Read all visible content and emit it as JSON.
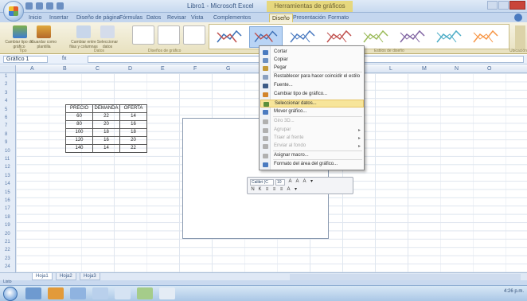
{
  "window": {
    "title": "Libro1 - Microsoft Excel",
    "context_title": "Herramientas de gráficos"
  },
  "tabs": [
    "Inicio",
    "Insertar",
    "Diseño de página",
    "Fórmulas",
    "Datos",
    "Revisar",
    "Vista",
    "Complementos",
    "Diseño",
    "Presentación",
    "Formato"
  ],
  "active_tab": "Diseño",
  "ribbon": {
    "buttons": [
      "Cambiar tipo de gráfico",
      "Guardar como plantilla",
      "Cambiar entre filas y columnas",
      "Seleccionar datos"
    ],
    "groups": [
      "Tipo",
      "Datos",
      "Diseños de gráfico",
      "Estilos de diseño",
      "Ubicación"
    ],
    "move_chart": "Mover gráfico"
  },
  "formula_bar": {
    "name_box": "Gráfico 1",
    "fx": "fx",
    "content": ""
  },
  "columns": [
    "A",
    "B",
    "C",
    "D",
    "E",
    "F",
    "G",
    "H",
    "I",
    "J",
    "K",
    "L",
    "M",
    "N",
    "O"
  ],
  "rows": [
    "1",
    "2",
    "3",
    "4",
    "5",
    "6",
    "7",
    "8",
    "9",
    "10",
    "11",
    "12",
    "13",
    "14",
    "15",
    "16",
    "17",
    "18",
    "19",
    "20",
    "21",
    "22",
    "23",
    "24"
  ],
  "table": {
    "headers": [
      "PRECIO",
      "DEMANDA",
      "OFERTA"
    ],
    "rows": [
      [
        "60",
        "22",
        "14"
      ],
      [
        "80",
        "20",
        "16"
      ],
      [
        "100",
        "18",
        "18"
      ],
      [
        "120",
        "16",
        "20"
      ],
      [
        "140",
        "14",
        "22"
      ]
    ]
  },
  "context_menu": {
    "items": [
      {
        "label": "Cortar",
        "icon": "scissors-icon",
        "color": "#4a7ac0",
        "disabled": false
      },
      {
        "label": "Copiar",
        "icon": "copy-icon",
        "color": "#6b8fc2",
        "disabled": false
      },
      {
        "label": "Pegar",
        "icon": "paste-icon",
        "color": "#c49a3a",
        "disabled": false
      },
      {
        "label": "Restablecer para hacer coincidir el estilo",
        "icon": "reset-style-icon",
        "color": "#8aa0c0",
        "disabled": false
      },
      {
        "label": "Fuente...",
        "icon": "font-icon",
        "color": "#3b5a86",
        "disabled": false
      },
      {
        "label": "Cambiar tipo de gráfico...",
        "icon": "chart-type-icon",
        "color": "#d2842b",
        "disabled": false
      },
      {
        "label": "Seleccionar datos...",
        "icon": "select-data-icon",
        "color": "#5b8f3b",
        "disabled": false,
        "highlighted": true
      },
      {
        "label": "Mover gráfico...",
        "icon": "move-chart-icon",
        "color": "#4a7ac0",
        "disabled": false
      },
      {
        "label": "Giro 3D...",
        "icon": "rotate-3d-icon",
        "color": "#b0b0b0",
        "disabled": true
      },
      {
        "label": "Agrupar",
        "icon": "group-icon",
        "color": "#b0b0b0",
        "disabled": true,
        "submenu": true
      },
      {
        "label": "Traer al frente",
        "icon": "bring-front-icon",
        "color": "#b0b0b0",
        "disabled": true,
        "submenu": true
      },
      {
        "label": "Enviar al fondo",
        "icon": "send-back-icon",
        "color": "#b0b0b0",
        "disabled": true,
        "submenu": true
      },
      {
        "label": "Asignar macro...",
        "icon": "macro-icon",
        "color": "#b0b0b0",
        "disabled": false
      },
      {
        "label": "Formato del área del gráfico...",
        "icon": "format-area-icon",
        "color": "#4a7ac0",
        "disabled": false
      }
    ]
  },
  "mini_toolbar": {
    "font": "Calibri (C",
    "size": "10",
    "buttons": [
      "A",
      "A",
      "A",
      "▾",
      "N",
      "K",
      "≡",
      "≡",
      "≡",
      "A",
      "▾"
    ]
  },
  "sheets": [
    "Hoja1",
    "Hoja2",
    "Hoja3"
  ],
  "active_sheet": "Hoja1",
  "status": "Listo",
  "tray_time": "4:26 p.m."
}
